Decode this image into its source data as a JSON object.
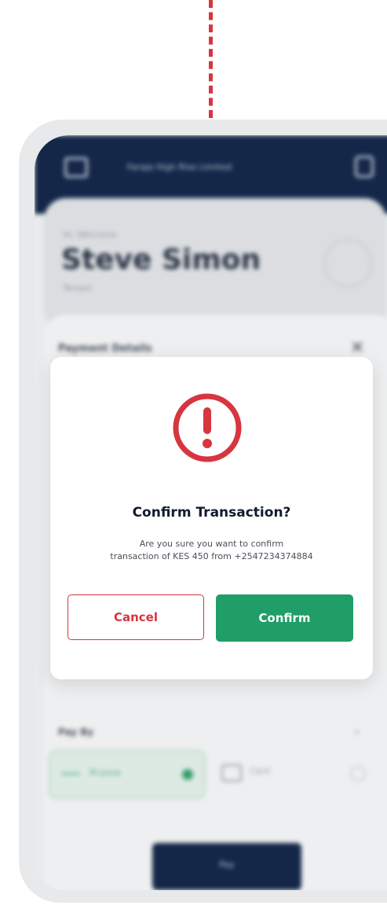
{
  "background_app": {
    "header_title": "Faraja High Rise Limited",
    "greeting": "Hi, Welcome",
    "user_name": "Steve Simon",
    "user_sub": "Tenant",
    "sheet_title": "Payment Details",
    "close_glyph": "✕",
    "pay_by_label": "Pay By",
    "option_mpesa": "M-pesa",
    "option_card": "Card",
    "pay_button": "Pay"
  },
  "dialog": {
    "title": "Confirm Transaction?",
    "message_line1": "Are you sure you want to confirm",
    "message_line2": "transaction of KES 450 from +2547234374884",
    "cancel_label": "Cancel",
    "confirm_label": "Confirm"
  },
  "colors": {
    "accent_red": "#d7353f",
    "confirm_green": "#1f9e67",
    "header_navy": "#15294d"
  }
}
